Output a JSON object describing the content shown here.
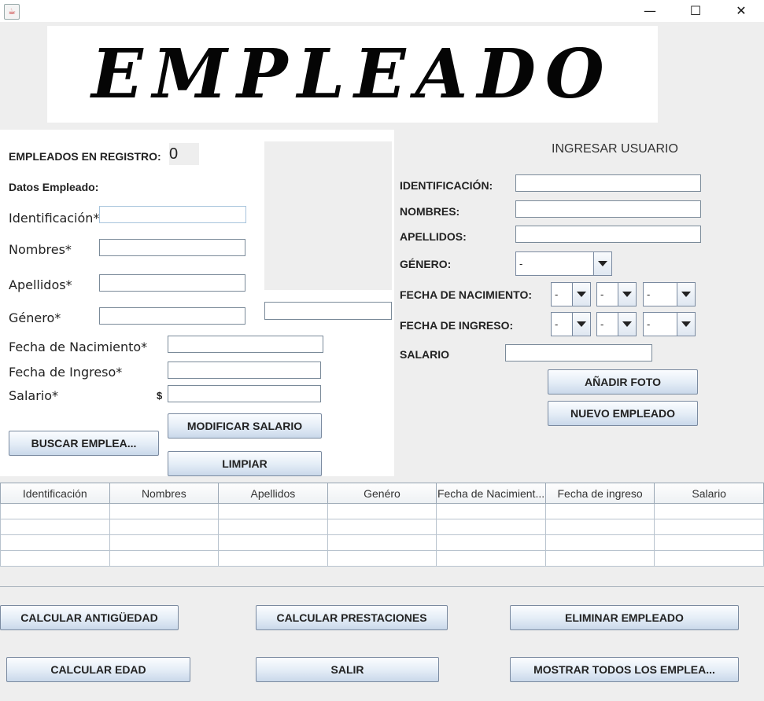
{
  "window": {
    "icon": "java-cup-icon",
    "controls": [
      "—",
      "☐",
      "✕"
    ]
  },
  "banner": {
    "text": "EMPLEADO"
  },
  "left": {
    "registro_label": "EMPLEADOS EN REGISTRO:",
    "registro_value": "0",
    "section_title": "Datos Empleado:",
    "fields": {
      "identificacion": "Identificación*",
      "nombres": "Nombres*",
      "apellidos": "Apellidos*",
      "genero": "Género*",
      "fecha_nacimiento": "Fecha de Nacimiento*",
      "fecha_ingreso": "Fecha de Ingreso*",
      "salario": "Salario*",
      "currency": "$"
    },
    "buttons": {
      "buscar": "BUSCAR EMPLEA...",
      "modificar_salario": "MODIFICAR SALARIO",
      "limpiar": "LIMPIAR"
    }
  },
  "right": {
    "title": "INGRESAR USUARIO",
    "labels": {
      "identificacion": "IDENTIFICACIÓN:",
      "nombres": "NOMBRES:",
      "apellidos": "APELLIDOS:",
      "genero": "GÉNERO:",
      "fecha_nacimiento": "FECHA DE NACIMIENTO:",
      "fecha_ingreso": "FECHA DE INGRESO:",
      "salario": "SALARIO"
    },
    "genero_selected": "-",
    "fecha_nacimiento_selected": [
      "-",
      "-",
      "-"
    ],
    "fecha_ingreso_selected": [
      "-",
      "-",
      "-"
    ],
    "buttons": {
      "anadir_foto": "AÑADIR FOTO",
      "nuevo_empleado": "NUEVO EMPLEADO"
    }
  },
  "table": {
    "headers": [
      "Identificación",
      "Nombres",
      "Apellidos",
      "Genéro",
      "Fecha de Nacimient...",
      "Fecha de ingreso",
      "Salario"
    ],
    "row_count": 4
  },
  "bottom_buttons": {
    "calcular_antiguedad": "CALCULAR ANTIGÜEDAD",
    "calcular_prestaciones": "CALCULAR PRESTACIONES",
    "eliminar_empleado": "ELIMINAR EMPLEADO",
    "calcular_edad": "CALCULAR EDAD",
    "salir": "SALIR",
    "mostrar_todos": "MOSTRAR TODOS LOS EMPLEA..."
  }
}
